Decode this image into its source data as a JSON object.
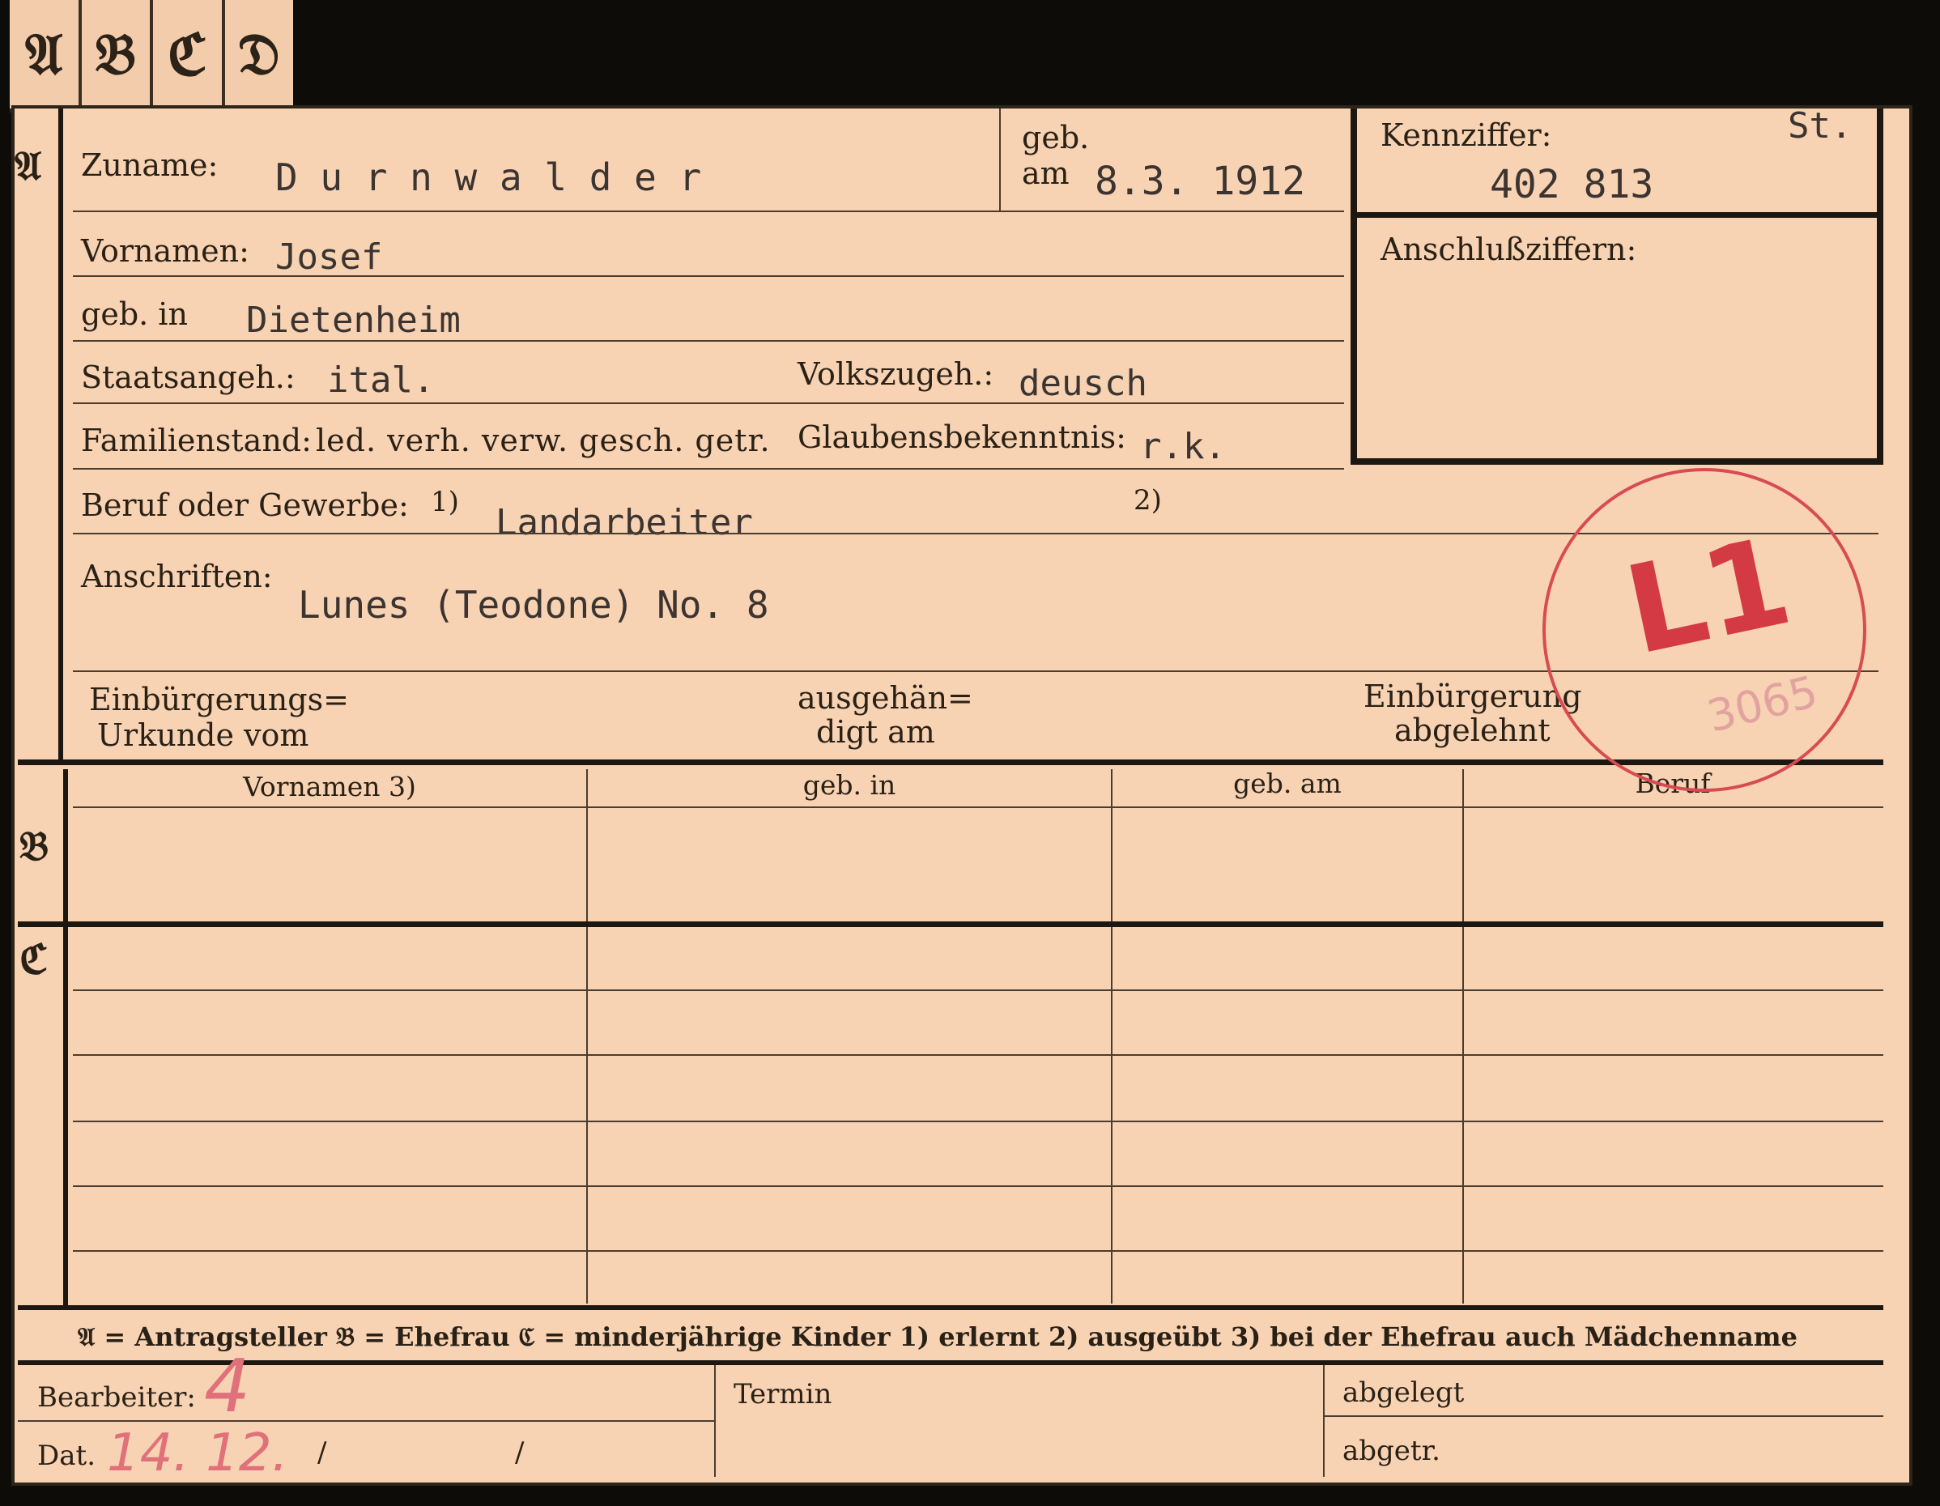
{
  "tabs": [
    "𝔄",
    "𝔅",
    "ℭ",
    "𝔇"
  ],
  "section_letters": {
    "a": "𝔄",
    "b": "𝔅",
    "c": "ℭ"
  },
  "fields": {
    "zuname_label": "Zuname:",
    "zuname_value": "D u r n w a l d e r",
    "geb_label": "geb.",
    "am_label": "am",
    "geb_am_value": "8.3. 1912",
    "kennziffer_label": "Kennziffer:",
    "kennziffer_st": "St.",
    "kennziffer_value": "402 813",
    "anschluss_label": "Anschlußziffern:",
    "vornamen_label": "Vornamen:",
    "vornamen_value": "Josef",
    "geb_in_label": "geb. in",
    "geb_in_value": "Dietenheim",
    "staatsangeh_label": "Staatsangeh.:",
    "staatsangeh_value": "ital.",
    "volkszugeh_label": "Volkszugeh.:",
    "volkszugeh_value": "deusch",
    "familienstand_label": "Familienstand:",
    "familienstand_options": "led. verh. verw. gesch. getr.",
    "glaubens_label": "Glaubensbekenntnis:",
    "glaubens_value": "r.k.",
    "beruf_label": "Beruf oder Gewerbe:",
    "beruf_note1": "1)",
    "beruf_value": "Landarbeiter",
    "beruf_note2": "2)",
    "anschriften_label": "Anschriften:",
    "anschriften_value": "Lunes (Teodone) No. 8",
    "einb_urkunde_label_1": "Einbürgerungs=",
    "einb_urkunde_label_2": "Urkunde vom",
    "ausgehaendigt_label_1": "ausgehän=",
    "ausgehaendigt_label_2": "digt am",
    "einb_abgelehnt_label_1": "Einbürgerung",
    "einb_abgelehnt_label_2": "abgelehnt"
  },
  "stamp": {
    "big": "L1",
    "small": "3065"
  },
  "table_b": {
    "headers": [
      "Vornamen 3)",
      "geb. in",
      "geb. am",
      "Beruf"
    ]
  },
  "legend": "𝔄 = Antragsteller   𝔅 = Ehefrau   ℭ = minderjährige Kinder   1) erlernt   2) ausgeübt   3) bei der Ehefrau auch Mädchenname",
  "footer": {
    "bearbeiter_label": "Bearbeiter:",
    "bearbeiter_mark": "4",
    "dat_label": "Dat.",
    "dat_value": "14. 12.",
    "slash1": "/",
    "slash2": "/",
    "termin_label": "Termin",
    "abgelegt_label": "abgelegt",
    "abgetr_label": "abgetr."
  }
}
